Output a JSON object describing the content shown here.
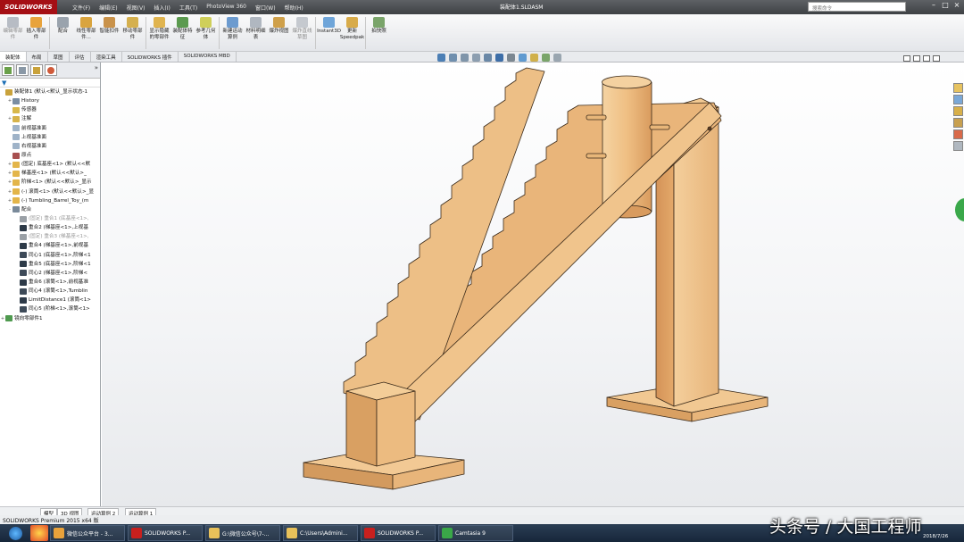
{
  "app": {
    "logo": "SOLIDWORKS",
    "menus": [
      "文件(F)",
      "编辑(E)",
      "视图(V)",
      "插入(I)",
      "工具(T)",
      "PhotoView 360",
      "窗口(W)",
      "帮助(H)"
    ],
    "document_title": "装配体1.SLDASM",
    "search_placeholder": "搜索命令"
  },
  "ribbon": {
    "buttons": [
      {
        "label": "编辑零部件",
        "icon": "edit-component-icon",
        "color": "#b7bcc4",
        "dim": true
      },
      {
        "label": "插入零部件",
        "icon": "insert-component-icon",
        "color": "#e8a33c",
        "dim": false
      },
      {
        "label": "配合",
        "icon": "mate-icon",
        "color": "#9aa3ad",
        "dim": false
      },
      {
        "label": "线性零部件...",
        "icon": "linear-pattern-icon",
        "color": "#d9a43e",
        "dim": false
      },
      {
        "label": "智能扣件",
        "icon": "smart-fastener-icon",
        "color": "#c9924a",
        "dim": false
      },
      {
        "label": "移动零部件",
        "icon": "move-component-icon",
        "color": "#d5b04e",
        "dim": false
      },
      {
        "label": "显示隐藏的零部件",
        "icon": "show-hidden-icon",
        "color": "#e0b44f",
        "dim": false
      },
      {
        "label": "装配体特征",
        "icon": "assembly-feature-icon",
        "color": "#5b9a4f",
        "dim": false
      },
      {
        "label": "参考几何体",
        "icon": "reference-geometry-icon",
        "color": "#cfcf5a",
        "dim": false
      },
      {
        "label": "新建运动算例",
        "icon": "motion-study-icon",
        "color": "#6c9bcf",
        "dim": false
      },
      {
        "label": "材料明细表",
        "icon": "bom-icon",
        "color": "#b0b7c0",
        "dim": false
      },
      {
        "label": "爆炸视图",
        "icon": "exploded-view-icon",
        "color": "#cfa04a",
        "dim": false
      },
      {
        "label": "爆炸直线草图",
        "icon": "explode-line-icon",
        "color": "#c5c9cf",
        "dim": true
      },
      {
        "label": "Instant3D",
        "icon": "instant3d-icon",
        "color": "#6fa5d9",
        "dim": false
      },
      {
        "label": "更新Speedpak",
        "icon": "speedpak-icon",
        "color": "#d8ab4a",
        "dim": false
      },
      {
        "label": "拍快照",
        "icon": "snapshot-icon",
        "color": "#7aa46a",
        "dim": false
      }
    ]
  },
  "command_tabs": [
    {
      "label": "装配体",
      "active": true
    },
    {
      "label": "布局",
      "active": false
    },
    {
      "label": "草图",
      "active": false
    },
    {
      "label": "评估",
      "active": false
    },
    {
      "label": "渲染工具",
      "active": false
    },
    {
      "label": "SOLIDWORKS 插件",
      "active": false
    },
    {
      "label": "SOLIDWORKS MBD",
      "active": false
    }
  ],
  "tree": [
    {
      "label": "装配体1 (默认<默认_显示状态-1",
      "indent": 0,
      "expander": "",
      "color": "#c9a23b",
      "suppressed": false
    },
    {
      "label": "History",
      "indent": 1,
      "expander": "+",
      "color": "#7a8ea3",
      "suppressed": false
    },
    {
      "label": "传感器",
      "indent": 1,
      "expander": "",
      "color": "#d8b84a",
      "suppressed": false
    },
    {
      "label": "注解",
      "indent": 1,
      "expander": "+",
      "color": "#d6b34a",
      "suppressed": false
    },
    {
      "label": "前视基准面",
      "indent": 1,
      "expander": "",
      "color": "#9fb3c8",
      "suppressed": false
    },
    {
      "label": "上视基准面",
      "indent": 1,
      "expander": "",
      "color": "#9fb3c8",
      "suppressed": false
    },
    {
      "label": "右视基准面",
      "indent": 1,
      "expander": "",
      "color": "#9fb3c8",
      "suppressed": false
    },
    {
      "label": "原点",
      "indent": 1,
      "expander": "",
      "color": "#a85050",
      "suppressed": false
    },
    {
      "label": "(固定) 底基座<1> (默认<<默",
      "indent": 1,
      "expander": "+",
      "color": "#e3b54a",
      "suppressed": false
    },
    {
      "label": "梯基座<1> (默认<<默认>_",
      "indent": 1,
      "expander": "+",
      "color": "#e3b54a",
      "suppressed": false
    },
    {
      "label": "阶梯<1> (默认<<默认>_显示",
      "indent": 1,
      "expander": "+",
      "color": "#e3b54a",
      "suppressed": false
    },
    {
      "label": "(-) 滚筒<1> (默认<<默认>_显",
      "indent": 1,
      "expander": "+",
      "color": "#e3b54a",
      "suppressed": false
    },
    {
      "label": "(-) Tumbling_Barrel_Toy_(m",
      "indent": 1,
      "expander": "+",
      "color": "#e3b54a",
      "suppressed": false
    },
    {
      "label": "配合",
      "indent": 1,
      "expander": "-",
      "color": "#7a8a9a",
      "suppressed": false
    },
    {
      "label": "(固定) 重合1 (底基座<1>,",
      "indent": 2,
      "expander": "",
      "color": "#9aa0a6",
      "suppressed": true
    },
    {
      "label": "重合2 (梯基座<1>,上视基",
      "indent": 2,
      "expander": "",
      "color": "#2d3a48",
      "suppressed": false
    },
    {
      "label": "(固定) 重合3 (梯基座<1>,",
      "indent": 2,
      "expander": "",
      "color": "#9aa0a6",
      "suppressed": true
    },
    {
      "label": "重合4 (梯基座<1>,前视基",
      "indent": 2,
      "expander": "",
      "color": "#2d3a48",
      "suppressed": false
    },
    {
      "label": "同心1 (底基座<1>,阶梯<1",
      "indent": 2,
      "expander": "",
      "color": "#3d4a58",
      "suppressed": false
    },
    {
      "label": "重合5 (底基座<1>,阶梯<1",
      "indent": 2,
      "expander": "",
      "color": "#2d3a48",
      "suppressed": false
    },
    {
      "label": "同心2 (梯基座<1>,阶梯<",
      "indent": 2,
      "expander": "",
      "color": "#3d4a58",
      "suppressed": false
    },
    {
      "label": "重合6 (滚筒<1>,前视基准",
      "indent": 2,
      "expander": "",
      "color": "#2d3a48",
      "suppressed": false
    },
    {
      "label": "同心4 (滚筒<1>,Tumblin",
      "indent": 2,
      "expander": "",
      "color": "#3d4a58",
      "suppressed": false
    },
    {
      "label": "LimitDistance1 (滚筒<1>",
      "indent": 2,
      "expander": "",
      "color": "#2d3a48",
      "suppressed": false
    },
    {
      "label": "同心5 (阶梯<1>,滚筒<1>",
      "indent": 2,
      "expander": "",
      "color": "#3d4a58",
      "suppressed": false
    },
    {
      "label": "镜向零部件1",
      "indent": 0,
      "expander": "+",
      "color": "#4f9a4f",
      "suppressed": false
    }
  ],
  "model_tabs": [
    "模型",
    "3D 视图",
    "运动算例 2",
    "运动算例 1"
  ],
  "status": "SOLIDWORKS Premium 2015 x64 版",
  "taskbar": {
    "tasks": [
      {
        "label": "微信公众平台 - 3...",
        "color": "#e9a23b"
      },
      {
        "label": "SOLIDWORKS P...",
        "color": "#c8201e"
      },
      {
        "label": "G:\\微信公众号\\7-...",
        "color": "#e8c15a"
      },
      {
        "label": "C:\\Users\\Admini...",
        "color": "#e8c15a"
      },
      {
        "label": "SOLIDWORKS P...",
        "color": "#c8201e"
      },
      {
        "label": "Camtasia 9",
        "color": "#3aa848"
      }
    ],
    "date": "2018/7/26"
  },
  "watermark": "头条号 / 大国工程师",
  "colors": {
    "wood_light": "#f0c48e",
    "wood_mid": "#e3a96c",
    "wood_dark": "#c98a4f",
    "titlebar": "#4a4d51",
    "accent_red": "#a50f14"
  }
}
